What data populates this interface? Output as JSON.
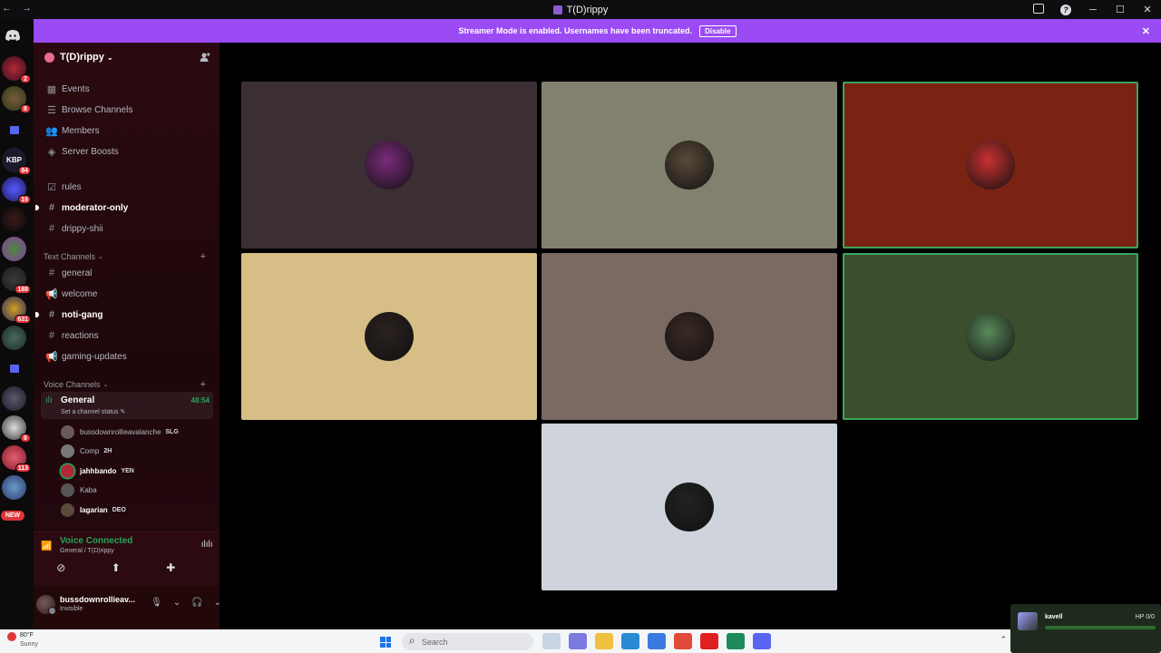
{
  "window": {
    "title": "T(D)rippy",
    "nav_arrows": "← →"
  },
  "streamer_banner": {
    "message": "Streamer Mode is enabled. Usernames have been truncated.",
    "button": "Disable"
  },
  "guild_rail": {
    "badges": [
      "2",
      "8",
      "84",
      "16",
      "188",
      "631",
      "8",
      "113"
    ],
    "new_label": "NEW",
    "guild_tag": "KBP"
  },
  "server": {
    "name": "T(D)rippy"
  },
  "nav_items": [
    {
      "label": "Events",
      "icon": "calendar-icon"
    },
    {
      "label": "Browse Channels",
      "icon": "list-icon"
    },
    {
      "label": "Members",
      "icon": "members-icon"
    },
    {
      "label": "Server Boosts",
      "icon": "boost-icon"
    }
  ],
  "channels_top": [
    {
      "label": "rules",
      "icon": "rules-icon",
      "bold": false
    },
    {
      "label": "moderator-only",
      "icon": "hash-icon",
      "bold": true
    },
    {
      "label": "drippy-shii",
      "icon": "hash-icon",
      "bold": false
    }
  ],
  "text_category": "Text Channels",
  "text_channels": [
    {
      "label": "general",
      "icon": "hash-icon",
      "bold": false
    },
    {
      "label": "welcome",
      "icon": "announce-icon",
      "bold": false
    },
    {
      "label": "noti-gang",
      "icon": "hash-icon",
      "bold": true
    },
    {
      "label": "reactions",
      "icon": "hash-icon",
      "bold": false
    },
    {
      "label": "gaming-updates",
      "icon": "announce-icon",
      "bold": false
    }
  ],
  "voice_category": "Voice Channels",
  "voice_channel": {
    "name": "General",
    "timer": "48:54",
    "status_placeholder": "Set a channel status ✎"
  },
  "voice_users": [
    {
      "name": "bussdownrollieavalanche",
      "tag": "SLG",
      "color": "#6b5a5a"
    },
    {
      "name": "Comp",
      "tag": "2H",
      "color": "#777777"
    },
    {
      "name": "jahhbando",
      "tag": "YEN",
      "color": "#b0283a"
    },
    {
      "name": "Kaba",
      "tag": "",
      "color": "#555555"
    },
    {
      "name": "Iagarian",
      "tag": "DEO",
      "color": "#5a4a3a"
    }
  ],
  "voice_panel": {
    "title": "Voice Connected",
    "subtitle": "General / T(D)rippy"
  },
  "user_panel": {
    "username": "bussdownrollieav...",
    "status": "Invisible"
  },
  "tiles": [
    {
      "bg": "#3b2f34",
      "speaking": false,
      "av": "#7a2a7a"
    },
    {
      "bg": "#82806f",
      "speaking": false,
      "av": "#5a4a3a"
    },
    {
      "bg": "#7a2312",
      "speaking": true,
      "av": "#c93030"
    },
    {
      "bg": "#d7be86",
      "speaking": false,
      "av": "#2a2220"
    },
    {
      "bg": "#7a6a62",
      "speaking": false,
      "av": "#3a2a25"
    },
    {
      "bg": "#3b4f2c",
      "speaking": true,
      "av": "#5a8a5a"
    },
    {
      "bg": "#cfd3db",
      "speaking": false,
      "av": "#222222"
    }
  ],
  "taskbar": {
    "temp": "80°F",
    "condition": "Sunny",
    "search_placeholder": "Search"
  },
  "toast": {
    "name": "kavell",
    "hp": "HP 0/0"
  }
}
